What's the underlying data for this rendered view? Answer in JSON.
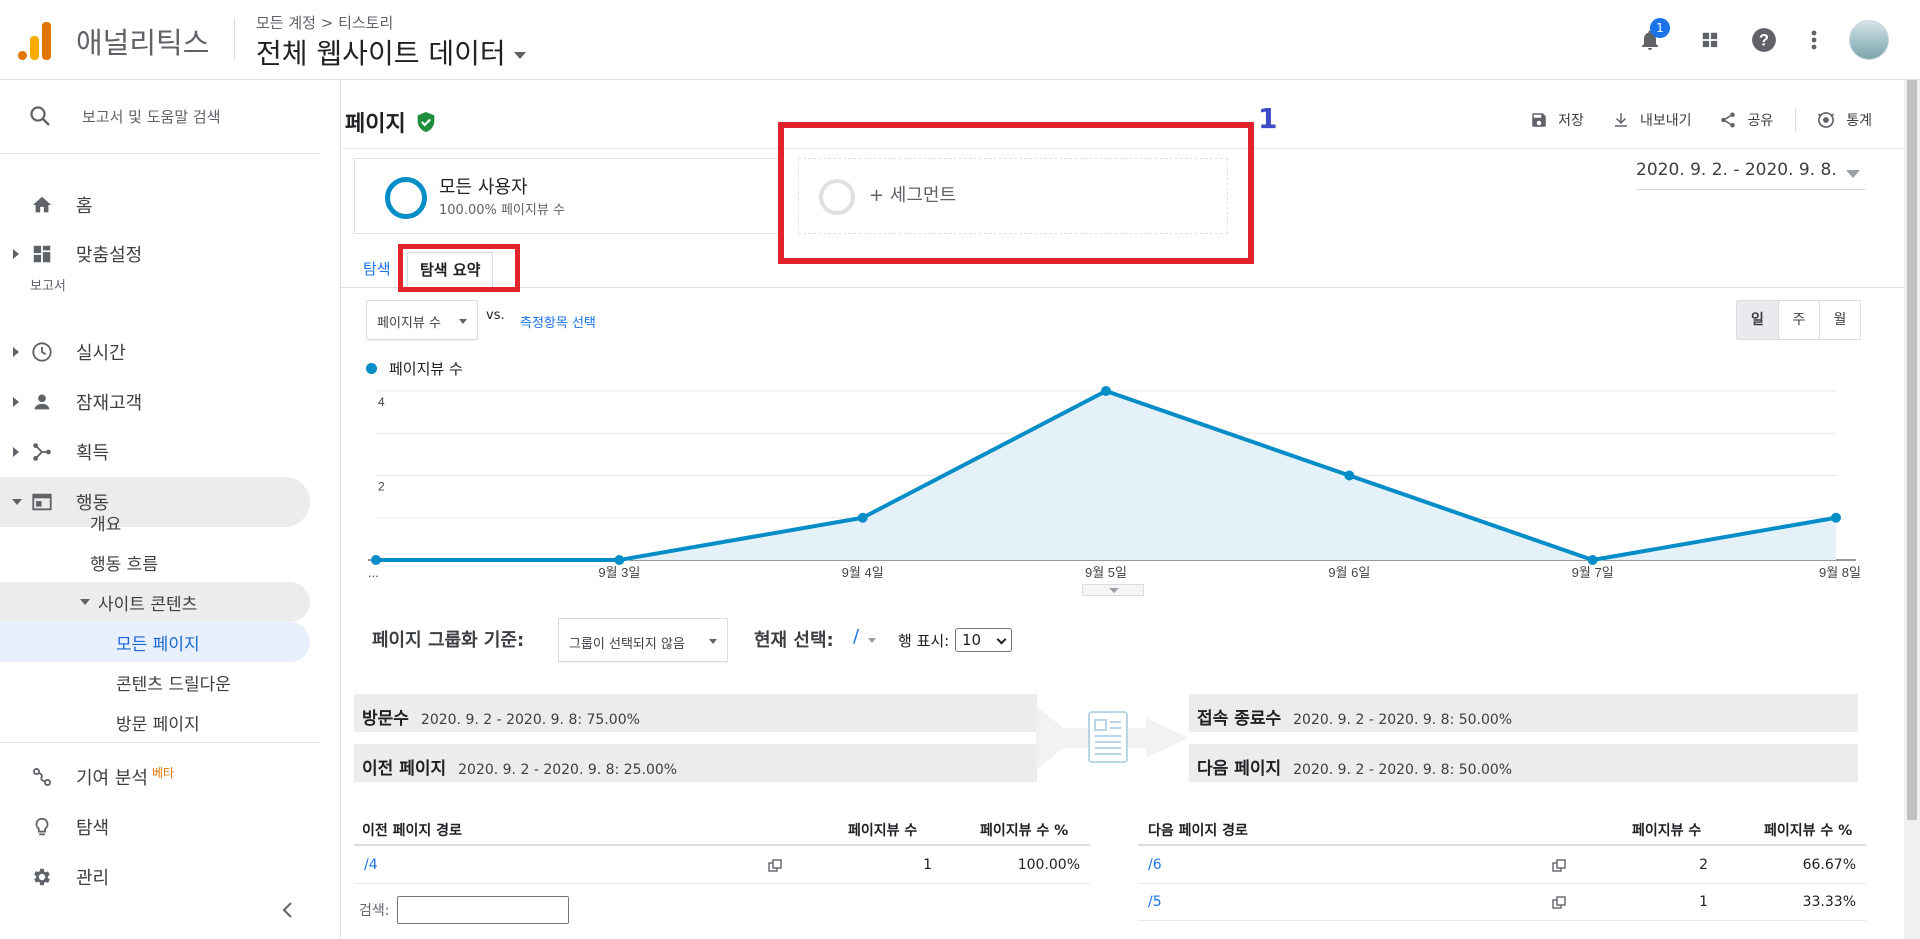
{
  "header": {
    "app_name": "애널리틱스",
    "breadcrumb": "모든 계정 > 티스토리",
    "view_title": "전체 웹사이트 데이터",
    "notification_count": "1"
  },
  "sidebar": {
    "search_placeholder": "보고서 및 도움말 검색",
    "section_label": "보고서",
    "items": [
      {
        "label": "홈",
        "icon": "home-icon"
      },
      {
        "label": "맞춤설정",
        "icon": "dashboard-icon"
      },
      {
        "label": "실시간",
        "icon": "clock-icon"
      },
      {
        "label": "잠재고객",
        "icon": "person-icon"
      },
      {
        "label": "획득",
        "icon": "acquisition-icon"
      },
      {
        "label": "행동",
        "icon": "behavior-icon"
      }
    ],
    "behavior_sub": [
      "개요",
      "행동 흐름"
    ],
    "site_content": "사이트 콘텐츠",
    "site_content_sub": [
      "모든 페이지",
      "콘텐츠 드릴다운",
      "방문 페이지"
    ],
    "bottom_items": [
      {
        "label": "기여 분석",
        "badge": "베타",
        "icon": "attribution-icon"
      },
      {
        "label": "탐색",
        "icon": "lightbulb-icon"
      },
      {
        "label": "관리",
        "icon": "gear-icon"
      }
    ]
  },
  "page": {
    "title": "페이지",
    "actions": {
      "save": "저장",
      "export": "내보내기",
      "share": "공유",
      "insights": "통계"
    },
    "annotation_number": "1",
    "segment": {
      "name": "모든 사용자",
      "sub": "100.00% 페이지뷰 수"
    },
    "add_segment": "+ 세그먼트",
    "date_range": "2020. 9. 2. - 2020. 9. 8.",
    "tabs": [
      "탐색",
      "탐색 요약"
    ],
    "metric_select": "페이지뷰 수",
    "vs": "vs.",
    "metric_link": "측정항목 선택",
    "period_buttons": [
      "일",
      "주",
      "월"
    ]
  },
  "chart_data": {
    "type": "area",
    "series": [
      {
        "name": "페이지뷰 수",
        "color": "#058dc7",
        "values": [
          0,
          0,
          1,
          4,
          2,
          0,
          1
        ]
      }
    ],
    "categories": [
      "...",
      "9월 3일",
      "9월 4일",
      "9월 5일",
      "9월 6일",
      "9월 7일",
      "9월 8일"
    ],
    "y_ticks": [
      "2",
      "4"
    ],
    "ylim": [
      0,
      4
    ],
    "grid": true
  },
  "navigation": {
    "group_label": "페이지 그룹화 기준:",
    "group_select": "그룹이 선택되지 않음",
    "current_label": "현재 선택:",
    "current_value": "/",
    "rows_label": "행 표시:",
    "rows_value": "10",
    "entrances": {
      "label": "방문수",
      "value": "2020. 9. 2 - 2020. 9. 8: 75.00%"
    },
    "previous": {
      "label": "이전 페이지",
      "value": "2020. 9. 2 - 2020. 9. 8: 25.00%"
    },
    "exits": {
      "label": "접속 종료수",
      "value": "2020. 9. 2 - 2020. 9. 8: 50.00%"
    },
    "next": {
      "label": "다음 페이지",
      "value": "2020. 9. 2 - 2020. 9. 8: 50.00%"
    },
    "prev_table": {
      "headers": [
        "이전 페이지 경로",
        "페이지뷰 수",
        "페이지뷰 수 %"
      ],
      "rows": [
        {
          "path": "/4",
          "views": "1",
          "pct": "100.00%"
        }
      ],
      "search_label": "검색:"
    },
    "next_table": {
      "headers": [
        "다음 페이지 경로",
        "페이지뷰 수",
        "페이지뷰 수 %"
      ],
      "rows": [
        {
          "path": "/6",
          "views": "2",
          "pct": "66.67%"
        },
        {
          "path": "/5",
          "views": "1",
          "pct": "33.33%"
        }
      ]
    }
  }
}
